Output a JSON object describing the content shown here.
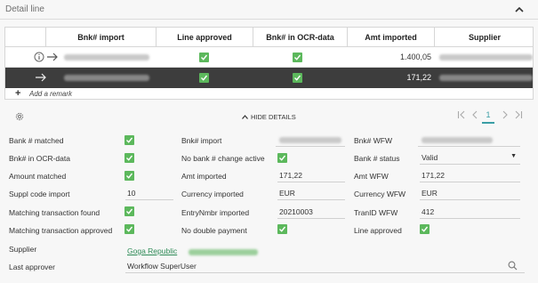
{
  "panel": {
    "title": "Detail line",
    "collapse_icon": "chevron-up-icon"
  },
  "grid": {
    "columns": [
      "Bnk# import",
      "Line approved",
      "Bnk# in OCR-data",
      "Amt imported",
      "Supplier"
    ],
    "rows": [
      {
        "amount": "1.400,05",
        "line_approved": true,
        "bnk_in_ocr": true,
        "selected": false,
        "icons": [
          "info-icon",
          "arrow-right-icon"
        ]
      },
      {
        "amount": "171,22",
        "line_approved": true,
        "bnk_in_ocr": true,
        "selected": true,
        "icons": [
          "arrow-right-icon"
        ]
      }
    ],
    "add_remark": "Add a remark"
  },
  "toolbar": {
    "hide_details": "HIDE DETAILS",
    "page": "1",
    "pager_icons": [
      "first-page-icon",
      "prev-page-icon",
      "next-page-icon",
      "last-page-icon"
    ]
  },
  "details": {
    "col1": [
      {
        "label": "Bank # matched",
        "checked": true
      },
      {
        "label": "Bnk# in OCR-data",
        "checked": true
      },
      {
        "label": "Amount matched",
        "checked": true
      },
      {
        "label": "Suppl code import",
        "value": "10"
      },
      {
        "label": "Matching transaction found",
        "checked": true
      },
      {
        "label": "Matching transaction approved",
        "checked": true
      }
    ],
    "col2": [
      {
        "label": "Bnk# import"
      },
      {
        "label": "No bank # change active",
        "checked": true
      },
      {
        "label": "Amt imported",
        "value": "171,22"
      },
      {
        "label": "Currency imported",
        "value": "EUR"
      },
      {
        "label": "EntryNmbr imported",
        "value": "20210003"
      },
      {
        "label": "No double payment",
        "checked": true
      }
    ],
    "col3": [
      {
        "label": "Bnk# WFW"
      },
      {
        "label": "Bank # status",
        "value": "Valid"
      },
      {
        "label": "Amt WFW",
        "value": "171,22"
      },
      {
        "label": "Currency WFW",
        "value": "EUR"
      },
      {
        "label": "TranID WFW",
        "value": "412"
      },
      {
        "label": "Line approved",
        "checked": true
      }
    ],
    "supplier_label": "Supplier",
    "supplier_value": "Goga Republic",
    "last_approver_label": "Last approver",
    "last_approver_value": "Workflow SuperUser"
  },
  "colors": {
    "check_green": "#5cb85c",
    "selected_row": "#3d3d3d",
    "accent_teal": "#3a9ea5",
    "link_green": "#2e8b57"
  }
}
